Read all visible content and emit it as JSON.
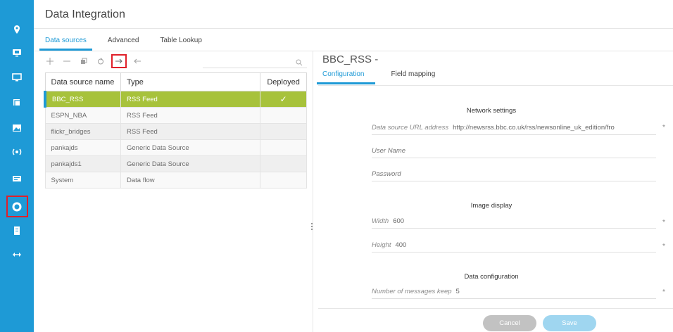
{
  "header": {
    "title": "Data Integration"
  },
  "main_tabs": [
    {
      "label": "Data sources",
      "active": true
    },
    {
      "label": "Advanced",
      "active": false
    },
    {
      "label": "Table Lookup",
      "active": false
    }
  ],
  "rail": {
    "items": [
      "location-icon",
      "display-icon",
      "monitor-icon",
      "layers-icon",
      "image-icon",
      "sensor-icon",
      "card-icon",
      "data-integration-icon",
      "document-icon",
      "expand-icon"
    ],
    "active": "data-integration-icon"
  },
  "toolbar": {
    "buttons": [
      "add-icon",
      "remove-icon",
      "copy-icon",
      "refresh-icon",
      "deploy-icon",
      "undeploy-icon"
    ],
    "highlighted": "deploy-icon"
  },
  "table": {
    "headers": [
      "Data source name",
      "Type",
      "Deployed"
    ],
    "rows": [
      {
        "name": "BBC_RSS",
        "type": "RSS Feed",
        "deployed": "✓",
        "selected": true
      },
      {
        "name": "ESPN_NBA",
        "type": "RSS Feed",
        "deployed": ""
      },
      {
        "name": "flickr_bridges",
        "type": "RSS Feed",
        "deployed": ""
      },
      {
        "name": "pankajds",
        "type": "Generic Data Source",
        "deployed": ""
      },
      {
        "name": "pankajds1",
        "type": "Generic Data Source",
        "deployed": ""
      },
      {
        "name": "System",
        "type": "Data flow",
        "deployed": ""
      }
    ]
  },
  "detail": {
    "title": "BBC_RSS -",
    "tabs": [
      {
        "label": "Configuration",
        "active": true
      },
      {
        "label": "Field mapping",
        "active": false
      }
    ],
    "sections": {
      "network": "Network settings",
      "image": "Image display",
      "data": "Data configuration"
    },
    "fields": {
      "url_label": "Data source URL address",
      "url_value": "http://newsrss.bbc.co.uk/rss/newsonline_uk_edition/fro",
      "username_placeholder": "User Name",
      "password_placeholder": "Password",
      "width_label": "Width",
      "width_value": "600",
      "height_label": "Height",
      "height_value": "400",
      "messages_label": "Number of messages keep",
      "messages_value": "5"
    },
    "required_mark": "*",
    "buttons": {
      "cancel": "Cancel",
      "save": "Save"
    }
  },
  "colors": {
    "rail": "#1e9ad6",
    "selected_row": "#a7c23b",
    "highlight_box": "#e0202a"
  }
}
